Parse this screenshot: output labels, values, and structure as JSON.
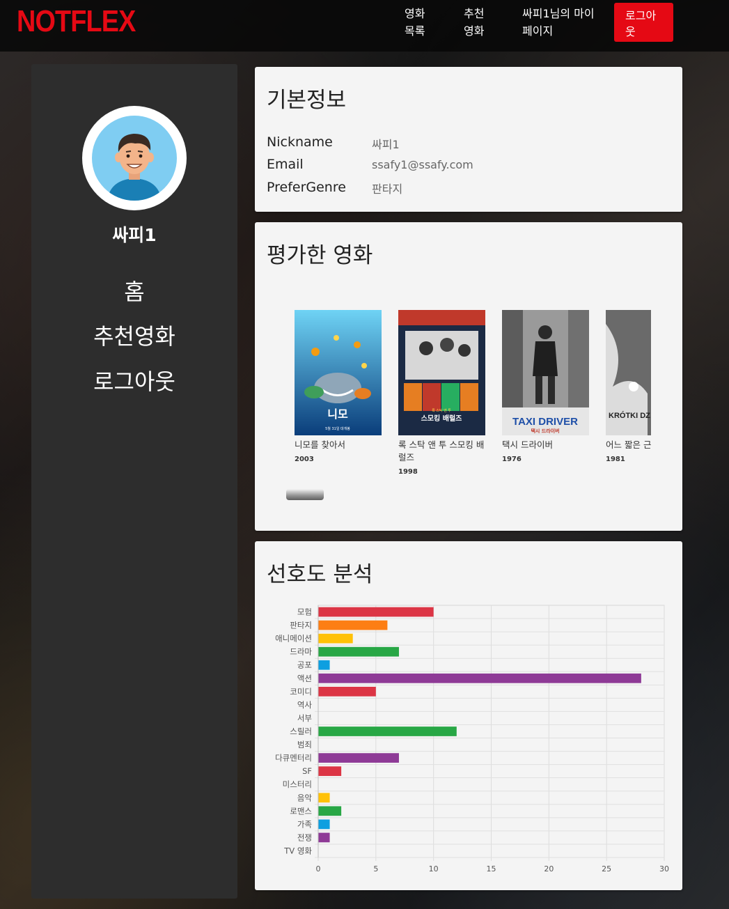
{
  "navbar": {
    "logo": "NOTFLEX",
    "links": [
      {
        "label_line1": "영화",
        "label_line2": "목록"
      },
      {
        "label_line1": "추천",
        "label_line2": "영화"
      },
      {
        "label_line1": "싸피1님의 마이",
        "label_line2": "페이지"
      }
    ],
    "logout_line1": "로그아",
    "logout_line2": "웃",
    "accent_color": "#e50914"
  },
  "sidebar": {
    "username": "싸피1",
    "links": [
      "홈",
      "추천영화",
      "로그아웃"
    ]
  },
  "profile": {
    "title": "기본정보",
    "fields": [
      {
        "key": "Nickname",
        "value": "싸피1"
      },
      {
        "key": "Email",
        "value": "ssafy1@ssafy.com"
      },
      {
        "key": "PreferGenre",
        "value": "판타지"
      }
    ]
  },
  "rated": {
    "title": "평가한 영화",
    "movies": [
      {
        "title": "니모를 찾아서",
        "year": "2003",
        "poster_text": "니모",
        "poster_sub": "5월 31일 대개봉"
      },
      {
        "title": "록 스탁 앤 투 스모킹 배럴즈",
        "year": "1998",
        "poster_text": "스모킹 배럴즈",
        "poster_sub": "록 스탁 앤 투"
      },
      {
        "title": "택시 드라이버",
        "year": "1976",
        "poster_text": "TAXI DRIVER",
        "poster_sub": "택시 드라이버"
      },
      {
        "title": "어느 짧은 근",
        "year": "1981",
        "poster_text": "KRÓTKI DZ",
        "poster_sub": ""
      }
    ]
  },
  "analysis": {
    "title": "선호도 분석"
  },
  "chart_data": {
    "type": "bar",
    "orientation": "horizontal",
    "categories": [
      "모험",
      "판타지",
      "애니메이션",
      "드라마",
      "공포",
      "액션",
      "코미디",
      "역사",
      "서부",
      "스릴러",
      "범죄",
      "다큐멘터리",
      "SF",
      "미스터리",
      "음악",
      "로맨스",
      "가족",
      "전쟁",
      "TV 영화"
    ],
    "values": [
      10,
      6,
      3,
      7,
      1,
      28,
      5,
      0,
      0,
      12,
      0,
      7,
      2,
      0,
      1,
      2,
      1,
      1,
      0
    ],
    "colors": [
      "#dc3545",
      "#fd7e14",
      "#ffc107",
      "#28a745",
      "#0d9fe0",
      "#8e3a96",
      "#dc3545",
      "#fd7e14",
      "#ffc107",
      "#28a745",
      "#0d9fe0",
      "#8e3a96",
      "#dc3545",
      "#fd7e14",
      "#ffc107",
      "#28a745",
      "#0d9fe0",
      "#8e3a96",
      "#dc3545"
    ],
    "xlim": [
      0,
      30
    ],
    "xticks": [
      0,
      5,
      10,
      15,
      20,
      25,
      30
    ],
    "grid": true
  }
}
